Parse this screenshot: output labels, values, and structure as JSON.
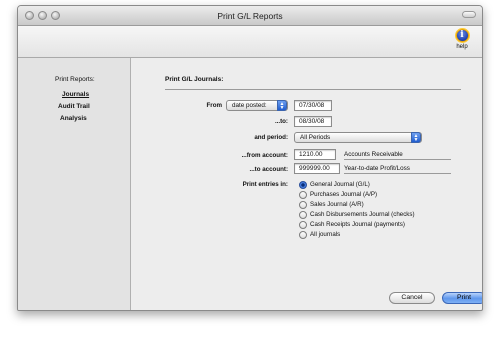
{
  "window": {
    "title": "Print G/L Reports"
  },
  "toolbar": {
    "help_label": "help"
  },
  "sidebar": {
    "heading": "Print Reports:",
    "items": [
      {
        "label": "Journals",
        "active": true
      },
      {
        "label": "Audit Trail",
        "active": false
      },
      {
        "label": "Analysis",
        "active": false
      }
    ]
  },
  "main": {
    "heading": "Print G/L Journals:",
    "from": {
      "label": "From",
      "date_type": "date posted:",
      "date_value": "07/30/08"
    },
    "to": {
      "label": "...to:",
      "date_value": "08/30/08"
    },
    "period": {
      "label": "and period:",
      "value": "All Periods"
    },
    "from_account": {
      "label": "...from account:",
      "value": "1210.00",
      "description": "Accounts Receivable"
    },
    "to_account": {
      "label": "...to account:",
      "value": "999999.00",
      "description": "Year-to-date Profit/Loss"
    },
    "print_entries": {
      "label": "Print entries in:",
      "options": [
        {
          "label": "General Journal (G/L)",
          "selected": true
        },
        {
          "label": "Purchases Journal (A/P)",
          "selected": false
        },
        {
          "label": "Sales Journal (A/R)",
          "selected": false
        },
        {
          "label": "Cash Disbursements Journal (checks)",
          "selected": false
        },
        {
          "label": "Cash Receipts Journal (payments)",
          "selected": false
        },
        {
          "label": "All journals",
          "selected": false
        }
      ]
    }
  },
  "buttons": {
    "cancel": "Cancel",
    "print": "Print"
  },
  "icons": {
    "help": "help-icon",
    "popup": "chevron-updown-icon"
  }
}
